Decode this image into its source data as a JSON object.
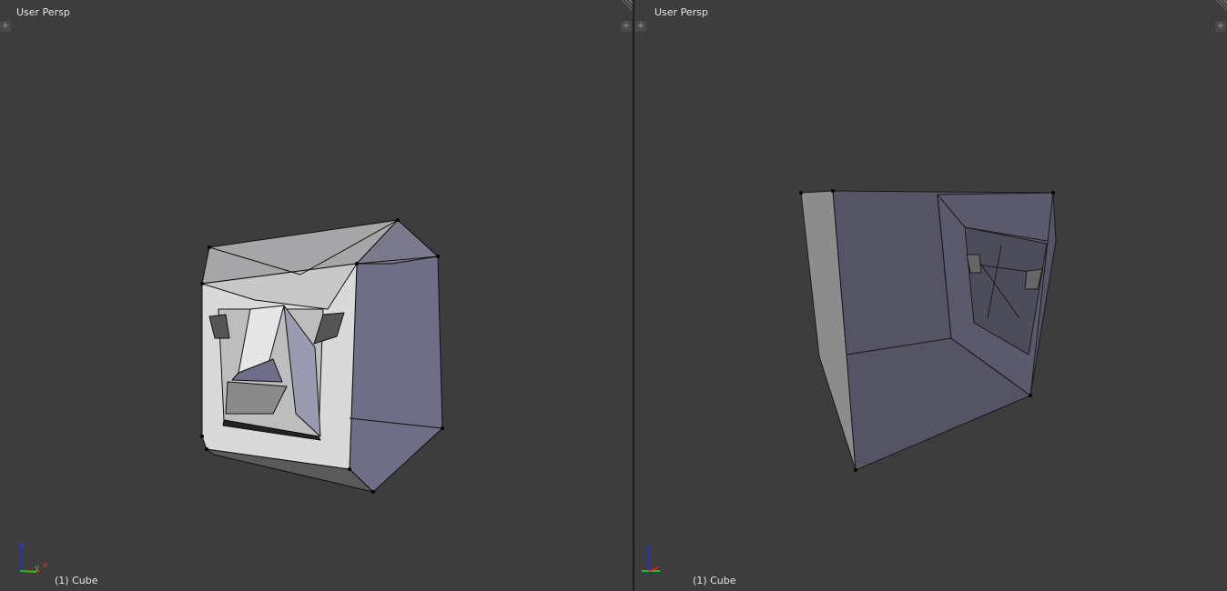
{
  "viewports": [
    {
      "view_label": "User Persp",
      "object_label": "(1) Cube"
    },
    {
      "view_label": "User Persp",
      "object_label": "(1) Cube"
    }
  ],
  "icons": {
    "add": "plus-icon",
    "split": "corner-split-icon",
    "axes": "axis-gizmo-icon"
  },
  "axis_labels": {
    "z": "z",
    "y": "y",
    "x": "x"
  },
  "colors": {
    "background": "#3d3d3d",
    "x_axis": "#cc2222",
    "y_axis": "#22bb22",
    "z_axis": "#2233cc",
    "mesh_face": "#c8c8cc",
    "mesh_shadow": "#5a5a72"
  }
}
